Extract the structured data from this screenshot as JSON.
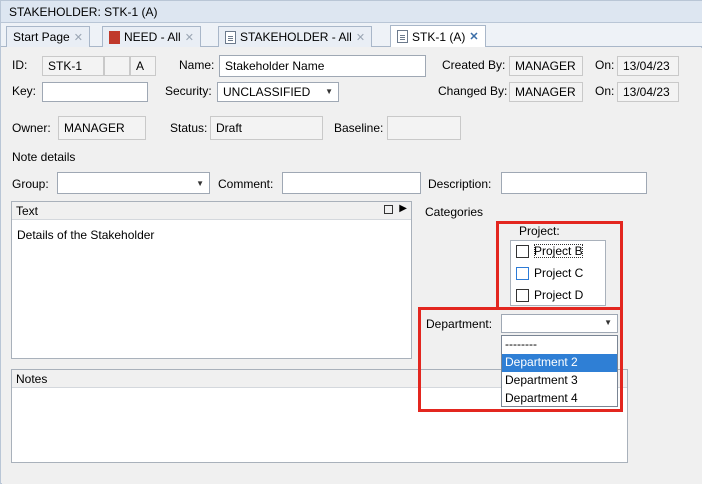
{
  "window": {
    "title": "STAKEHOLDER: STK-1 (A)"
  },
  "tabs": [
    {
      "label": "Start Page",
      "close": "✕"
    },
    {
      "label": "NEED - All",
      "close": "✕"
    },
    {
      "label": "STAKEHOLDER - All",
      "close": "✕"
    },
    {
      "label": "STK-1 (A)",
      "close": "✕"
    }
  ],
  "form": {
    "id_label": "ID:",
    "id_value": "STK-1",
    "id_extra": "",
    "id_version": "A",
    "name_label": "Name:",
    "name_value": "Stakeholder Name",
    "created_by_label": "Created By:",
    "created_by_value": "MANAGER",
    "created_on_label": "On:",
    "created_on_value": "13/04/23",
    "key_label": "Key:",
    "key_value": "",
    "security_label": "Security:",
    "security_value": "UNCLASSIFIED",
    "changed_by_label": "Changed By:",
    "changed_by_value": "MANAGER",
    "changed_on_label": "On:",
    "changed_on_value": "13/04/23",
    "owner_label": "Owner:",
    "owner_value": "MANAGER",
    "status_label": "Status:",
    "status_value": "Draft",
    "baseline_label": "Baseline:",
    "baseline_value": "",
    "note_details_label": "Note details",
    "group_label": "Group:",
    "group_value": "",
    "comment_label": "Comment:",
    "comment_value": "",
    "description_label": "Description:",
    "description_value": ""
  },
  "text_panel": {
    "header": "Text",
    "body": "Details of the Stakeholder"
  },
  "notes_panel": {
    "header": "Notes",
    "body": ""
  },
  "categories": {
    "header": "Categories",
    "project_label": "Project:",
    "projects": [
      {
        "label": "Project B",
        "checked": false
      },
      {
        "label": "Project C",
        "checked": false
      },
      {
        "label": "Project D",
        "checked": false
      }
    ],
    "department_label": "Department:",
    "department_value": "",
    "department_options": [
      "--------",
      "Department 2",
      "Department 3",
      "Department 4"
    ],
    "department_highlighted": "Department 2"
  },
  "colors": {
    "highlight_box": "#e3261f",
    "selection": "#2f7fd5",
    "titlebar": "#dde6f1"
  }
}
